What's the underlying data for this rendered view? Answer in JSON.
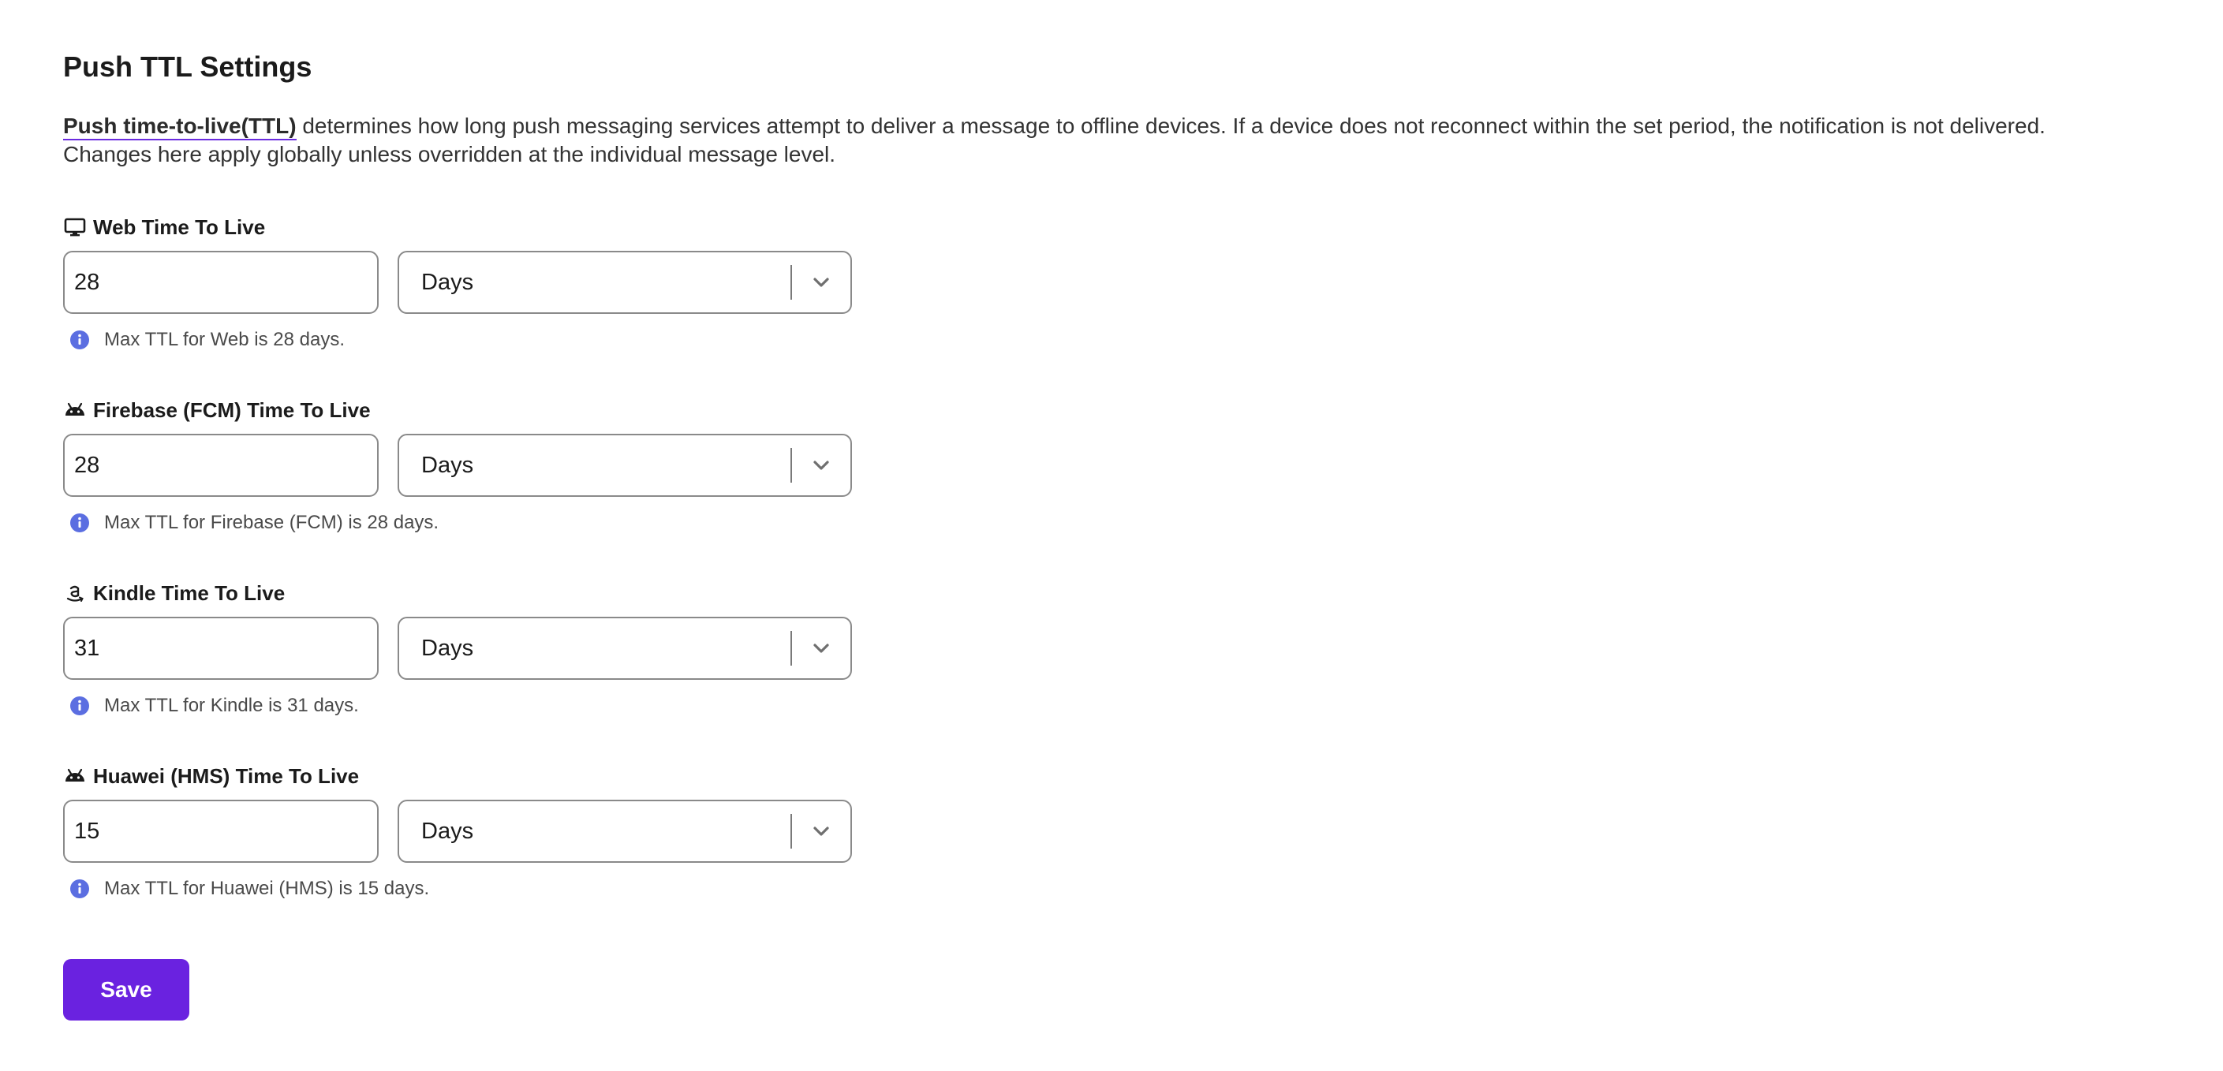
{
  "page": {
    "title": "Push TTL Settings",
    "description_link": "Push time-to-live(TTL)",
    "description_text": " determines how long push messaging services attempt to deliver a message to offline devices. If a device does not reconnect within the set period, the notification is not delivered. Changes here apply globally unless overridden at the individual message level."
  },
  "fields": [
    {
      "label": "Web Time To Live",
      "icon": "monitor-icon",
      "value": "28",
      "unit": "Days",
      "hint": "Max TTL for Web is 28 days."
    },
    {
      "label": "Firebase (FCM) Time To Live",
      "icon": "android-icon",
      "value": "28",
      "unit": "Days",
      "hint": "Max TTL for Firebase (FCM) is 28 days."
    },
    {
      "label": "Kindle Time To Live",
      "icon": "amazon-icon",
      "value": "31",
      "unit": "Days",
      "hint": "Max TTL for Kindle is 31 days."
    },
    {
      "label": "Huawei (HMS) Time To Live",
      "icon": "android-icon",
      "value": "15",
      "unit": "Days",
      "hint": "Max TTL for Huawei (HMS) is 15 days."
    }
  ],
  "actions": {
    "save_label": "Save"
  },
  "colors": {
    "accent": "#6a22e0",
    "info": "#5b6ee1",
    "border": "#8a8a8a"
  }
}
